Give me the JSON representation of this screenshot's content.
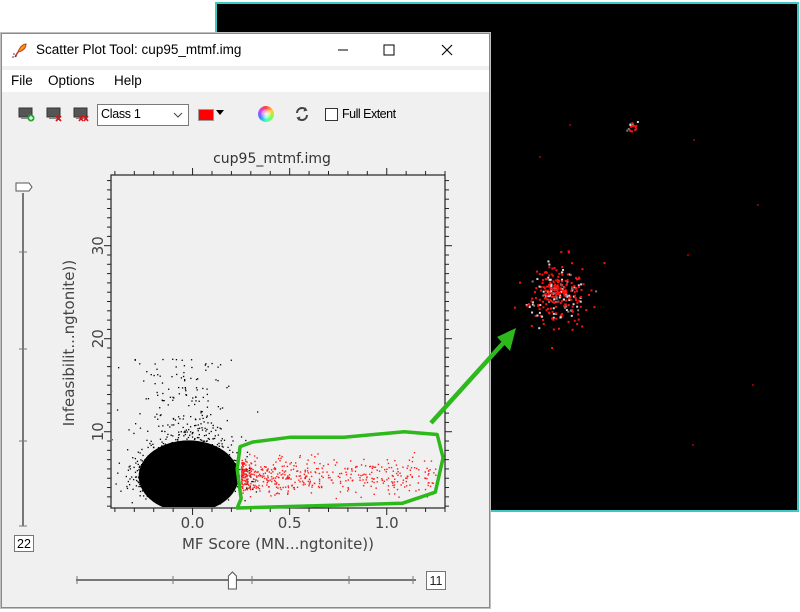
{
  "window": {
    "title": "Scatter Plot Tool: cup95_mtmf.img",
    "controls": {
      "minimize": "minimize",
      "maximize": "maximize",
      "close": "close"
    }
  },
  "menu": [
    {
      "label": "File"
    },
    {
      "label": "Options"
    },
    {
      "label": "Help"
    }
  ],
  "toolbar": {
    "icons": [
      "add-class-icon",
      "delete-class-icon",
      "delete-all-classes-icon"
    ],
    "class_select": {
      "value": "Class 1"
    },
    "class_color": "#ff0000",
    "full_extent": {
      "label": "Full Extent",
      "checked": false
    }
  },
  "colors": {
    "roi_polygon": "#2db81c",
    "class_points": "#ff1a1a",
    "density_points": "#000000",
    "image_border": "#3cc9c6",
    "plot_background": "#f0f0f0"
  },
  "sliders": {
    "vertical": {
      "value": "22",
      "position_fraction": 1.0
    },
    "horizontal": {
      "value": "11",
      "position_fraction": 0.46
    }
  },
  "chart_data": {
    "type": "scatter",
    "title": "cup95_mtmf.img",
    "xlabel": "MF Score (MN...ngtonite))",
    "ylabel": "Infeasibilit...ngtonite))",
    "xlim": [
      -0.42,
      1.3
    ],
    "ylim": [
      1.8,
      37.6
    ],
    "x_ticks": [
      0.0,
      0.5,
      1.0
    ],
    "x_tick_labels": [
      "0.0",
      "0.5",
      "1.0"
    ],
    "y_ticks": [
      10,
      20,
      30
    ],
    "y_tick_labels": [
      "10",
      "20",
      "30"
    ],
    "grid": false,
    "series": [
      {
        "name": "all pixels",
        "color": "#000000",
        "description": "dense cluster centered near MF 0.0, infeasibility ~5, spread MF -0.3..0.3, infeasibility 2..18"
      },
      {
        "name": "Class 1",
        "color": "#ff0000",
        "description": "pixels inside ROI polygon, MF 0.25..1.25, infeasibility ~3..8"
      }
    ],
    "roi_polygon": [
      [
        0.25,
        2.8
      ],
      [
        0.23,
        6.0
      ],
      [
        0.245,
        8.4
      ],
      [
        0.31,
        8.9
      ],
      [
        0.5,
        9.4
      ],
      [
        0.78,
        9.4
      ],
      [
        1.09,
        10.0
      ],
      [
        1.26,
        9.7
      ],
      [
        1.29,
        7.2
      ],
      [
        1.25,
        3.5
      ],
      [
        1.08,
        2.3
      ],
      [
        0.23,
        1.8
      ]
    ]
  },
  "annotation": {
    "arrow": "green arrow from ROI polygon to classified region in image"
  }
}
